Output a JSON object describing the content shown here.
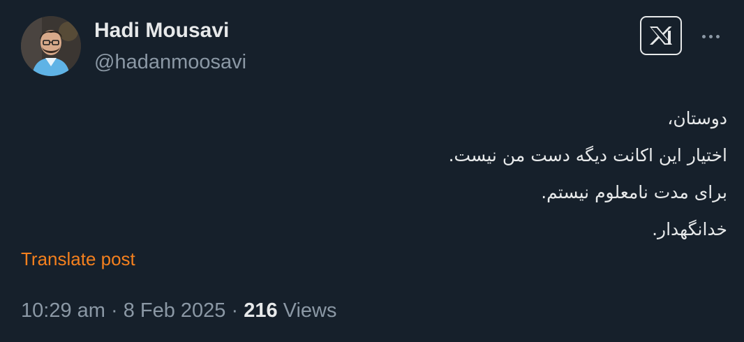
{
  "author": {
    "display_name": "Hadi Mousavi",
    "handle": "@hadanmoosavi",
    "avatar_icon": "profile-photo"
  },
  "header": {
    "logo_icon": "x-logo-icon",
    "more_icon": "more-horizontal-icon"
  },
  "post": {
    "lines": [
      "دوستان،",
      "اختیار این اکانت دیگه دست من نیست.",
      "برای مدت نامعلوم نیستم.",
      "خدانگهدار."
    ],
    "translate_label": "Translate post"
  },
  "meta": {
    "time": "10:29 am",
    "separator": " · ",
    "date": "8 Feb 2025",
    "views_count": "216",
    "views_label": "Views"
  },
  "colors": {
    "background": "#16202b",
    "primary_text": "#e7e9ea",
    "secondary_text": "#8b98a5",
    "link": "#f4801e"
  }
}
